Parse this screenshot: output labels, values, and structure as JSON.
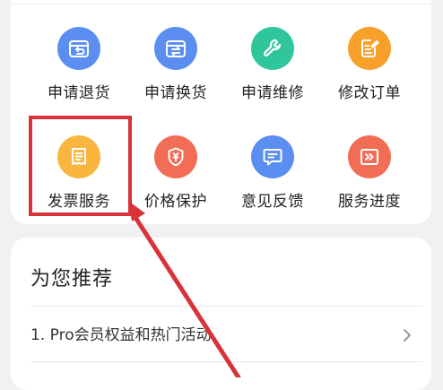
{
  "services": [
    {
      "label": "申请退货",
      "icon": "return-box-icon",
      "color": "#5b8ef1"
    },
    {
      "label": "申请换货",
      "icon": "exchange-box-icon",
      "color": "#5b8ef1"
    },
    {
      "label": "申请维修",
      "icon": "wrench-icon",
      "color": "#2fc69c"
    },
    {
      "label": "修改订单",
      "icon": "edit-document-icon",
      "color": "#f7a12b"
    },
    {
      "label": "发票服务",
      "icon": "receipt-icon",
      "color": "#f9b53d"
    },
    {
      "label": "价格保护",
      "icon": "price-shield-icon",
      "color": "#f26d55"
    },
    {
      "label": "意见反馈",
      "icon": "feedback-message-icon",
      "color": "#5b8ef1"
    },
    {
      "label": "服务进度",
      "icon": "progress-forward-icon",
      "color": "#f26d55"
    }
  ],
  "recommend": {
    "title": "为您推荐",
    "items": [
      {
        "label": "1. Pro会员权益和热门活动"
      }
    ]
  },
  "annotation": {
    "color": "#d9333a"
  }
}
